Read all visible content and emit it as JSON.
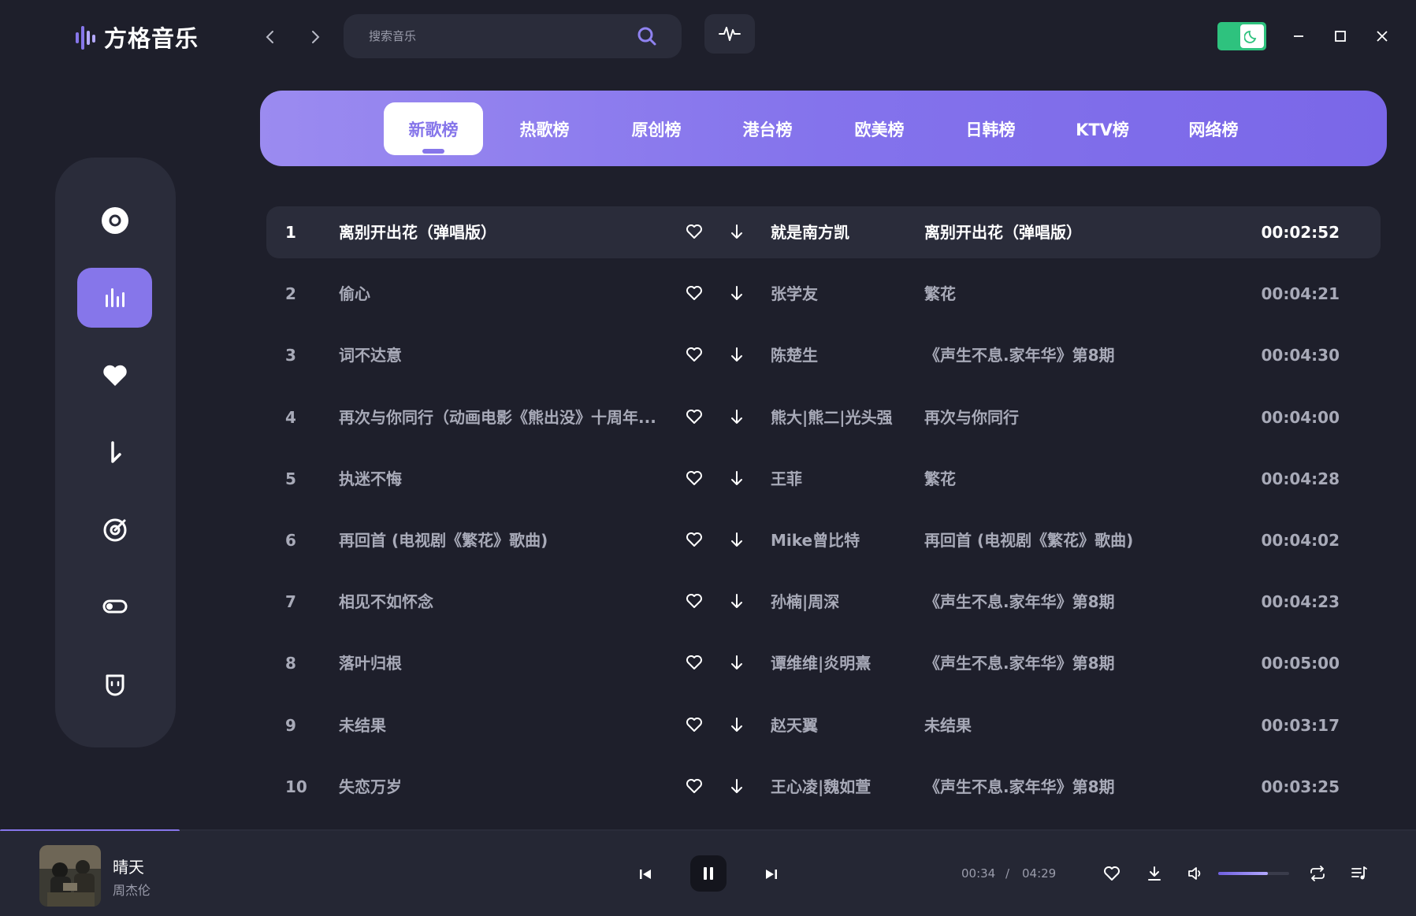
{
  "app": {
    "name": "方格音乐"
  },
  "search": {
    "placeholder": "搜索音乐"
  },
  "tabs": [
    {
      "label": "新歌榜",
      "active": true
    },
    {
      "label": "热歌榜",
      "active": false
    },
    {
      "label": "原创榜",
      "active": false
    },
    {
      "label": "港台榜",
      "active": false
    },
    {
      "label": "欧美榜",
      "active": false
    },
    {
      "label": "日韩榜",
      "active": false
    },
    {
      "label": "KTV榜",
      "active": false
    },
    {
      "label": "网络榜",
      "active": false
    }
  ],
  "sidebar": {
    "items": [
      {
        "icon": "disc-icon",
        "active": false
      },
      {
        "icon": "chart-icon",
        "active": true
      },
      {
        "icon": "heart-icon",
        "active": false
      },
      {
        "icon": "download-icon",
        "active": false
      },
      {
        "icon": "radar-icon",
        "active": false
      },
      {
        "icon": "toggle-icon",
        "active": false
      },
      {
        "icon": "smile-icon",
        "active": false
      }
    ]
  },
  "songs": [
    {
      "num": "1",
      "title": "离别开出花（弹唱版）",
      "artist": "就是南方凯",
      "album": "离别开出花（弹唱版）",
      "duration": "00:02:52"
    },
    {
      "num": "2",
      "title": "偷心",
      "artist": "张学友",
      "album": "繁花",
      "duration": "00:04:21"
    },
    {
      "num": "3",
      "title": "词不达意",
      "artist": "陈楚生",
      "album": "《声生不息.家年华》第8期",
      "duration": "00:04:30"
    },
    {
      "num": "4",
      "title": "再次与你同行（动画电影《熊出没》十周年...",
      "artist": "熊大|熊二|光头强",
      "album": "再次与你同行",
      "duration": "00:04:00"
    },
    {
      "num": "5",
      "title": "执迷不悔",
      "artist": "王菲",
      "album": "繁花",
      "duration": "00:04:28"
    },
    {
      "num": "6",
      "title": "再回首 (电视剧《繁花》歌曲)",
      "artist": "Mike曾比特",
      "album": "再回首 (电视剧《繁花》歌曲)",
      "duration": "00:04:02"
    },
    {
      "num": "7",
      "title": "相见不如怀念",
      "artist": "孙楠|周深",
      "album": "《声生不息.家年华》第8期",
      "duration": "00:04:23"
    },
    {
      "num": "8",
      "title": "落叶归根",
      "artist": "谭维维|炎明熹",
      "album": "《声生不息.家年华》第8期",
      "duration": "00:05:00"
    },
    {
      "num": "9",
      "title": "未结果",
      "artist": "赵天翼",
      "album": "未结果",
      "duration": "00:03:17"
    },
    {
      "num": "10",
      "title": "失恋万岁",
      "artist": "王心凌|魏如萱",
      "album": "《声生不息.家年华》第8期",
      "duration": "00:03:25"
    }
  ],
  "player": {
    "song": "晴天",
    "artist": "周杰伦",
    "current_time": "00:34",
    "separator": "/",
    "total_time": "04:29",
    "progress": 0.127,
    "volume": 0.7
  },
  "colors": {
    "accent": "#8676ea",
    "background": "#1e1f2b",
    "panel": "#2a2c3a",
    "toggle": "#2ec27e"
  }
}
